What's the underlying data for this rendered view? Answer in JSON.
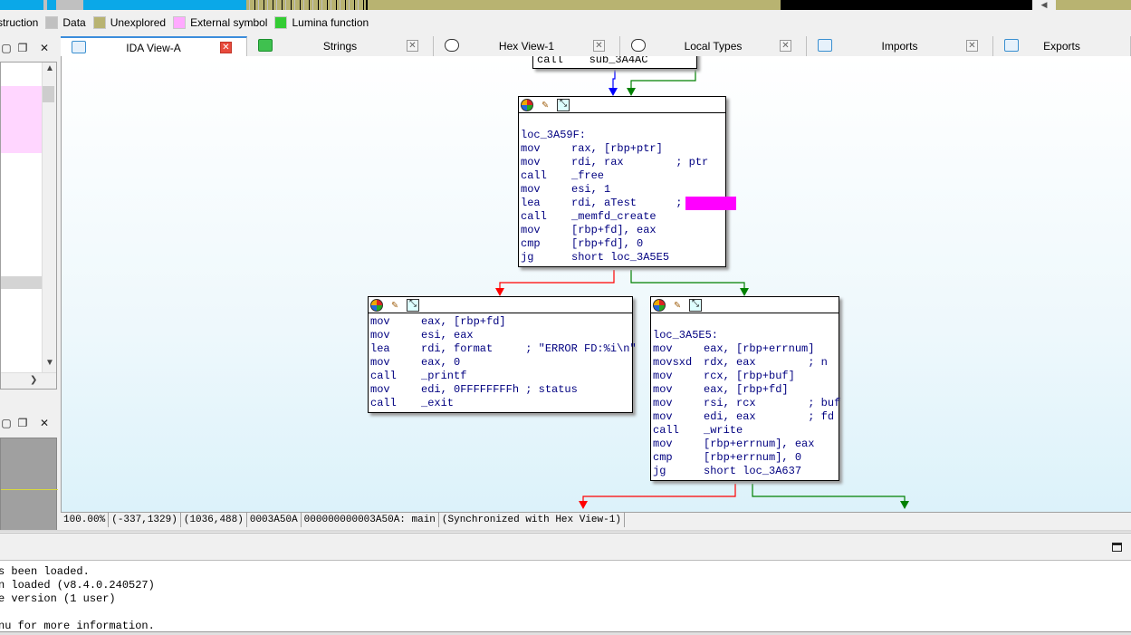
{
  "legend": [
    {
      "label": "struction",
      "color": ""
    },
    {
      "label": "Data",
      "color": "#c0c0c0"
    },
    {
      "label": "Unexplored",
      "color": "#b8b371"
    },
    {
      "label": "External symbol",
      "color": "#ffaaff"
    },
    {
      "label": "Lumina function",
      "color": "#33cc33"
    }
  ],
  "nav_colors": {
    "code": "#0aa8e8",
    "data": "#c0c0c0",
    "unexplored": "#b8b371",
    "dark": "#000000"
  },
  "tabs": [
    {
      "label": "IDA View-A",
      "icon": "ida-view-icon",
      "active": true
    },
    {
      "label": "Strings",
      "icon": "strings-icon",
      "active": false
    },
    {
      "label": "Hex View-1",
      "icon": "hex-view-icon",
      "active": false
    },
    {
      "label": "Local Types",
      "icon": "local-types-icon",
      "active": false
    },
    {
      "label": "Imports",
      "icon": "imports-icon",
      "active": false
    },
    {
      "label": "Exports",
      "icon": "exports-icon",
      "active": false
    }
  ],
  "blocks": {
    "top_partial": {
      "line": "call    sub_3A4AC"
    },
    "main": {
      "lines": [
        {
          "m": "",
          "o": ""
        },
        {
          "m": "loc_3A59F:",
          "o": ""
        },
        {
          "m": "mov",
          "o": "rax, [rbp+ptr]"
        },
        {
          "m": "mov",
          "o": "rdi, rax        ; ptr"
        },
        {
          "m": "call",
          "o": "_free"
        },
        {
          "m": "mov",
          "o": "esi, 1"
        },
        {
          "m": "lea",
          "o": "rdi, aTest      ;"
        },
        {
          "m": "call",
          "o": "_memfd_create"
        },
        {
          "m": "mov",
          "o": "[rbp+fd], eax"
        },
        {
          "m": "cmp",
          "o": "[rbp+fd], 0"
        },
        {
          "m": "jg",
          "o": "short loc_3A5E5"
        }
      ]
    },
    "left": {
      "lines": [
        {
          "m": "mov",
          "o": "eax, [rbp+fd]"
        },
        {
          "m": "mov",
          "o": "esi, eax"
        },
        {
          "m": "lea",
          "o": "rdi, format     ; \"ERROR FD:%i\\n\""
        },
        {
          "m": "mov",
          "o": "eax, 0"
        },
        {
          "m": "call",
          "o": "_printf"
        },
        {
          "m": "mov",
          "o": "edi, 0FFFFFFFFh ; status"
        },
        {
          "m": "call",
          "o": "_exit"
        }
      ]
    },
    "right": {
      "lines": [
        {
          "m": "",
          "o": ""
        },
        {
          "m": "loc_3A5E5:",
          "o": ""
        },
        {
          "m": "mov",
          "o": "eax, [rbp+errnum]"
        },
        {
          "m": "movsxd",
          "o": "rdx, eax        ; n"
        },
        {
          "m": "mov",
          "o": "rcx, [rbp+buf]"
        },
        {
          "m": "mov",
          "o": "eax, [rbp+fd]"
        },
        {
          "m": "mov",
          "o": "rsi, rcx        ; buf"
        },
        {
          "m": "mov",
          "o": "edi, eax        ; fd"
        },
        {
          "m": "call",
          "o": "_write"
        },
        {
          "m": "mov",
          "o": "[rbp+errnum], eax"
        },
        {
          "m": "cmp",
          "o": "[rbp+errnum], 0"
        },
        {
          "m": "jg",
          "o": "short loc_3A637"
        }
      ]
    }
  },
  "edge_colors": {
    "true": "#008000",
    "false": "#ff0000",
    "uncond": "#0000ff"
  },
  "highlight_color": "#ff00ff",
  "status": [
    "100.00%",
    "(-337,1329)",
    "(1036,488)",
    "0003A50A",
    "000000000003A50A: main",
    "(Synchronized with Hex View-1)"
  ],
  "output_lines": [
    "s been loaded.",
    "n loaded (v8.4.0.240527)",
    "e version (1 user)",
    "",
    "nu for more information."
  ]
}
